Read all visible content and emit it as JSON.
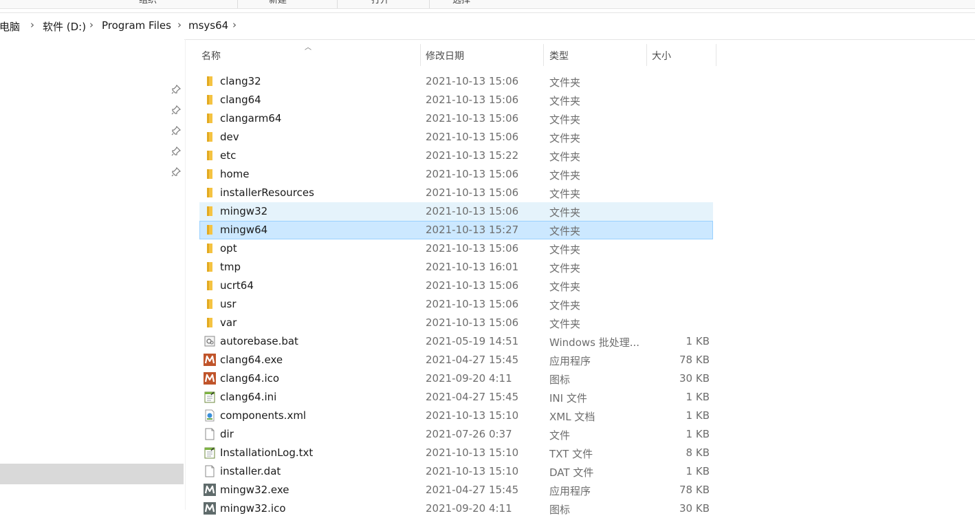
{
  "ribbon": {
    "groups": [
      "组织",
      "新建",
      "打开",
      "选择"
    ]
  },
  "breadcrumb": {
    "items": [
      "此电脑",
      "软件 (D:)",
      "Program Files",
      "msys64"
    ]
  },
  "columns": {
    "name": "名称",
    "date": "修改日期",
    "type": "类型",
    "size": "大小"
  },
  "files": [
    {
      "name": "clang32",
      "date": "2021-10-13 15:06",
      "type": "文件夹",
      "size": "",
      "icon": "folder-icon"
    },
    {
      "name": "clang64",
      "date": "2021-10-13 15:06",
      "type": "文件夹",
      "size": "",
      "icon": "folder-icon"
    },
    {
      "name": "clangarm64",
      "date": "2021-10-13 15:06",
      "type": "文件夹",
      "size": "",
      "icon": "folder-icon"
    },
    {
      "name": "dev",
      "date": "2021-10-13 15:06",
      "type": "文件夹",
      "size": "",
      "icon": "folder-icon"
    },
    {
      "name": "etc",
      "date": "2021-10-13 15:22",
      "type": "文件夹",
      "size": "",
      "icon": "folder-icon"
    },
    {
      "name": "home",
      "date": "2021-10-13 15:06",
      "type": "文件夹",
      "size": "",
      "icon": "folder-icon"
    },
    {
      "name": "installerResources",
      "date": "2021-10-13 15:06",
      "type": "文件夹",
      "size": "",
      "icon": "folder-icon"
    },
    {
      "name": "mingw32",
      "date": "2021-10-13 15:06",
      "type": "文件夹",
      "size": "",
      "icon": "folder-icon",
      "state": "hover"
    },
    {
      "name": "mingw64",
      "date": "2021-10-13 15:27",
      "type": "文件夹",
      "size": "",
      "icon": "folder-icon",
      "state": "selected"
    },
    {
      "name": "opt",
      "date": "2021-10-13 15:06",
      "type": "文件夹",
      "size": "",
      "icon": "folder-icon"
    },
    {
      "name": "tmp",
      "date": "2021-10-13 16:01",
      "type": "文件夹",
      "size": "",
      "icon": "folder-icon"
    },
    {
      "name": "ucrt64",
      "date": "2021-10-13 15:06",
      "type": "文件夹",
      "size": "",
      "icon": "folder-icon"
    },
    {
      "name": "usr",
      "date": "2021-10-13 15:06",
      "type": "文件夹",
      "size": "",
      "icon": "folder-icon"
    },
    {
      "name": "var",
      "date": "2021-10-13 15:06",
      "type": "文件夹",
      "size": "",
      "icon": "folder-icon"
    },
    {
      "name": "autorebase.bat",
      "date": "2021-05-19 14:51",
      "type": "Windows 批处理...",
      "size": "1 KB",
      "icon": "batch-file-icon"
    },
    {
      "name": "clang64.exe",
      "date": "2021-04-27 15:45",
      "type": "应用程序",
      "size": "78 KB",
      "icon": "msys-clang-icon"
    },
    {
      "name": "clang64.ico",
      "date": "2021-09-20 4:11",
      "type": "图标",
      "size": "30 KB",
      "icon": "msys-clang-icon"
    },
    {
      "name": "clang64.ini",
      "date": "2021-04-27 15:45",
      "type": "INI 文件",
      "size": "1 KB",
      "icon": "notepad-file-icon"
    },
    {
      "name": "components.xml",
      "date": "2021-10-13 15:10",
      "type": "XML 文档",
      "size": "1 KB",
      "icon": "xml-file-icon"
    },
    {
      "name": "dir",
      "date": "2021-07-26 0:37",
      "type": "文件",
      "size": "1 KB",
      "icon": "blank-file-icon"
    },
    {
      "name": "InstallationLog.txt",
      "date": "2021-10-13 15:10",
      "type": "TXT 文件",
      "size": "8 KB",
      "icon": "notepad-file-icon"
    },
    {
      "name": "installer.dat",
      "date": "2021-10-13 15:10",
      "type": "DAT 文件",
      "size": "1 KB",
      "icon": "blank-file-icon"
    },
    {
      "name": "mingw32.exe",
      "date": "2021-04-27 15:45",
      "type": "应用程序",
      "size": "78 KB",
      "icon": "msys-mingw-icon"
    },
    {
      "name": "mingw32.ico",
      "date": "2021-09-20 4:11",
      "type": "图标",
      "size": "30 KB",
      "icon": "msys-mingw-icon"
    }
  ],
  "colors": {
    "folder": "#f5c342",
    "hover_row": "#e5f3fb",
    "selected_row": "#cce8ff",
    "selected_border": "#99d1ff",
    "clang_icon": "#c0542a",
    "mingw_icon": "#5f6b6b",
    "nav_selected": "#d9d9d9"
  }
}
